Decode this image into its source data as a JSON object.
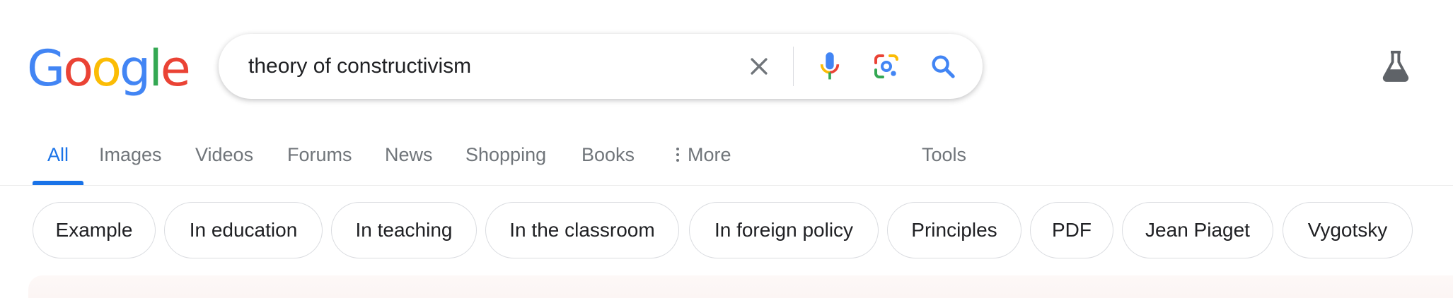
{
  "logo": {
    "letters": [
      "G",
      "o",
      "o",
      "g",
      "l",
      "e"
    ],
    "colors": [
      "#4285f4",
      "#ea4335",
      "#fbbc05",
      "#4285f4",
      "#34a853",
      "#ea4335"
    ]
  },
  "search": {
    "query": "theory of constructivism"
  },
  "icons": {
    "clear": "close-icon",
    "mic": "microphone-icon",
    "lens": "camera-lens-icon",
    "search": "search-icon",
    "labs": "flask-icon",
    "more": "vertical-dots-icon"
  },
  "tabs": [
    {
      "label": "All",
      "active": true
    },
    {
      "label": "Images"
    },
    {
      "label": "Videos"
    },
    {
      "label": "Forums"
    },
    {
      "label": "News"
    },
    {
      "label": "Shopping"
    },
    {
      "label": "Books"
    },
    {
      "label": "More"
    },
    {
      "label": "Tools"
    }
  ],
  "chips": [
    "Example",
    "In education",
    "In teaching",
    "In the classroom",
    "In foreign policy",
    "Principles",
    "PDF",
    "Jean Piaget",
    "Vygotsky"
  ],
  "colors": {
    "accent": "#1a73e8",
    "tab_text": "#70757a",
    "text": "#202124",
    "border": "#dadce0"
  }
}
